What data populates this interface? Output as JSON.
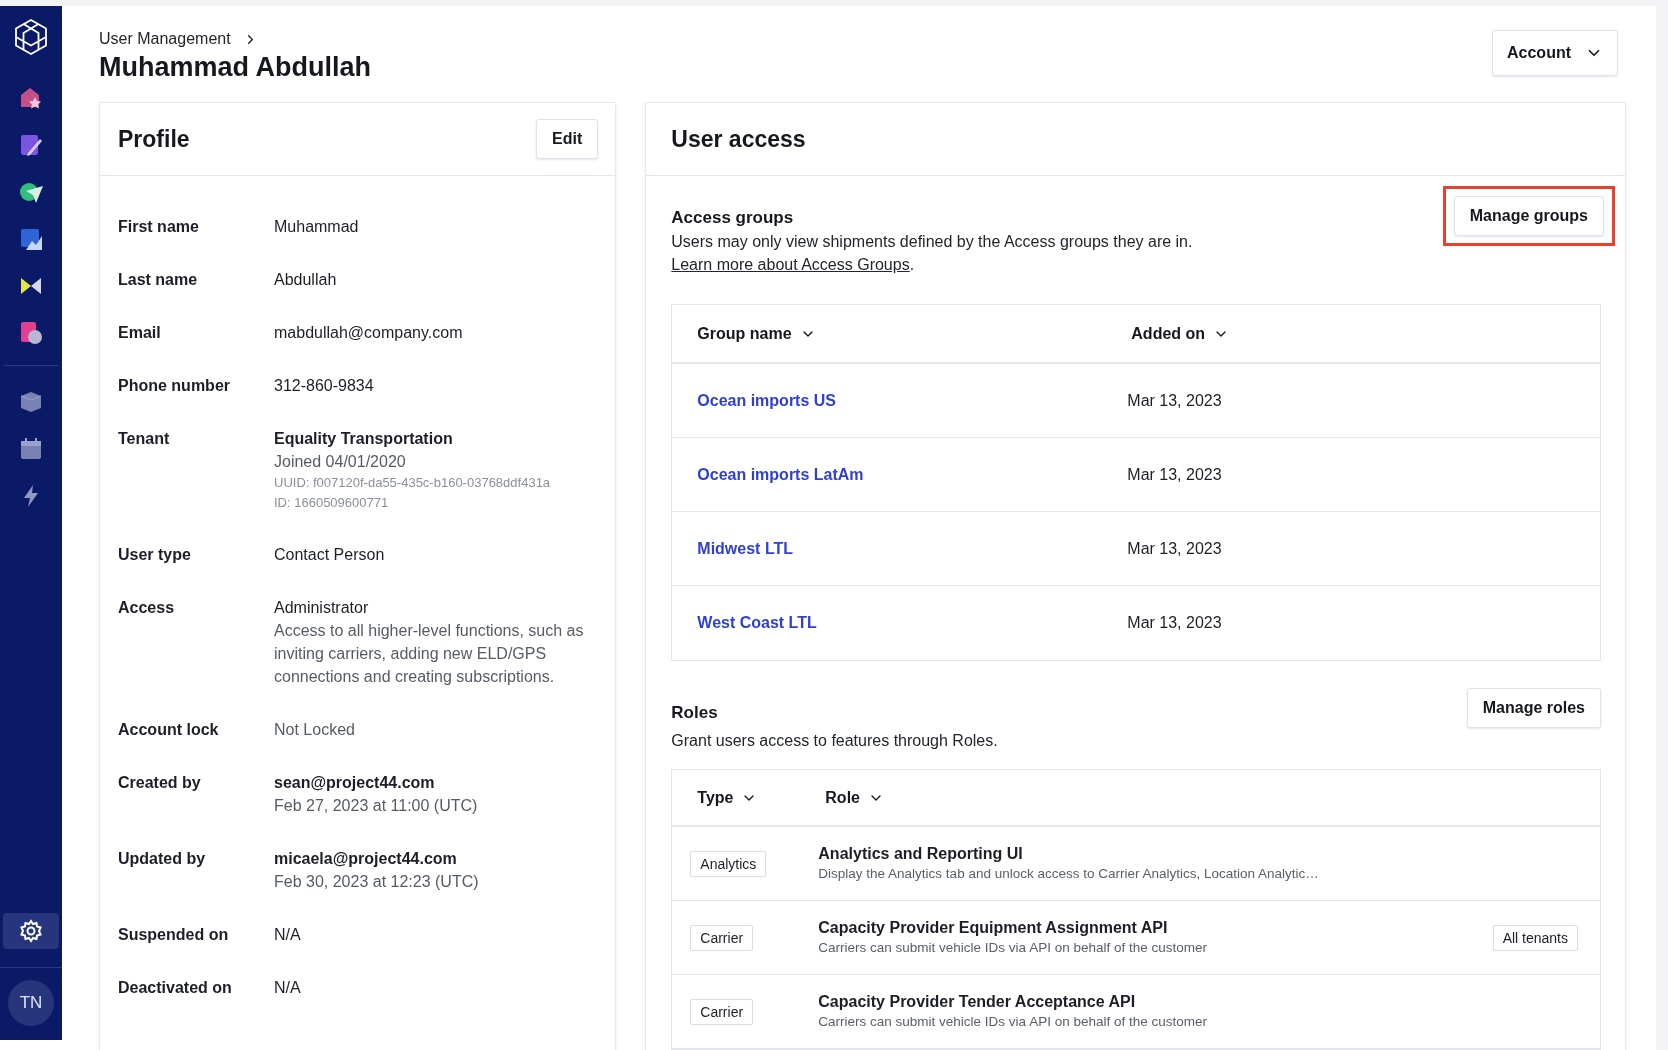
{
  "sidebar": {
    "primary": [
      {
        "selected": false
      },
      {
        "selected": false
      },
      {
        "selected": false
      },
      {
        "selected": false
      },
      {
        "selected": false
      },
      {
        "selected": false
      }
    ],
    "secondary": [
      {
        "selected": false
      },
      {
        "selected": false
      },
      {
        "selected": false
      }
    ],
    "footer": [
      {
        "selected": true
      }
    ],
    "avatar": {
      "initials": "TN"
    }
  },
  "header": {
    "breadcrumb": "User Management",
    "title": "Muhammad Abdullah",
    "account_button": "Account"
  },
  "profile": {
    "title": "Profile",
    "edit_button": "Edit",
    "fields": [
      {
        "label": "First name",
        "lines": [
          {
            "kind": "value",
            "text": "Muhammad"
          }
        ]
      },
      {
        "label": "Last name",
        "lines": [
          {
            "kind": "value",
            "text": "Abdullah"
          }
        ]
      },
      {
        "label": "Email",
        "lines": [
          {
            "kind": "value",
            "text": "mabdullah@company.com"
          }
        ]
      },
      {
        "label": "Phone number",
        "lines": [
          {
            "kind": "value",
            "text": "312-860-9834"
          }
        ]
      },
      {
        "label": "Tenant",
        "lines": [
          {
            "kind": "strong",
            "text": "Equality Transportation"
          },
          {
            "kind": "secondary",
            "text": "Joined 04/01/2020"
          },
          {
            "kind": "meta",
            "text": "UUID: f007120f-da55-435c-b160-03768ddf431a"
          },
          {
            "kind": "meta",
            "text": "ID: 1660509600771"
          }
        ]
      },
      {
        "label": "User type",
        "lines": [
          {
            "kind": "value",
            "text": "Contact Person"
          }
        ]
      },
      {
        "label": "Access",
        "lines": [
          {
            "kind": "value",
            "text": "Administrator"
          },
          {
            "kind": "secondary",
            "text": "Access to all higher-level functions, such as inviting carriers, adding new ELD/GPS connections and creating subscriptions."
          }
        ]
      },
      {
        "label": "Account lock",
        "lines": [
          {
            "kind": "secondary",
            "text": "Not Locked"
          }
        ]
      },
      {
        "label": "Created by",
        "lines": [
          {
            "kind": "strong",
            "text": "sean@project44.com"
          },
          {
            "kind": "secondary",
            "text": "Feb 27, 2023 at 11:00 (UTC)"
          }
        ]
      },
      {
        "label": "Updated by",
        "lines": [
          {
            "kind": "strong",
            "text": "micaela@project44.com"
          },
          {
            "kind": "secondary",
            "text": "Feb 30, 2023 at 12:23 (UTC)"
          }
        ]
      },
      {
        "label": "Suspended on",
        "lines": [
          {
            "kind": "value",
            "text": "N/A"
          }
        ]
      },
      {
        "label": "Deactivated on",
        "lines": [
          {
            "kind": "value",
            "text": "N/A"
          }
        ]
      }
    ]
  },
  "user_access": {
    "title": "User access",
    "access_groups": {
      "title": "Access groups",
      "description": "Users may only view shipments defined by the Access groups they are in.",
      "link": "Learn more about Access Groups",
      "link_suffix": ".",
      "button": "Manage groups",
      "button_highlighted": true,
      "columns": [
        "Group name",
        "Added on"
      ],
      "rows": [
        {
          "name": "Ocean imports US",
          "added_on": "Mar 13, 2023"
        },
        {
          "name": "Ocean imports LatAm",
          "added_on": "Mar 13, 2023"
        },
        {
          "name": "Midwest LTL",
          "added_on": "Mar 13, 2023"
        },
        {
          "name": "West Coast LTL",
          "added_on": "Mar 13, 2023"
        }
      ]
    },
    "roles": {
      "title": "Roles",
      "description": "Grant users access to features through Roles.",
      "button": "Manage roles",
      "columns": [
        "Type",
        "Role"
      ],
      "rows": [
        {
          "type": "Analytics",
          "role": "Analytics and Reporting UI",
          "description": "Display the Analytics tab and unlock access to Carrier Analytics, Location Analytic…"
        },
        {
          "type": "Carrier",
          "role": "Capacity Provider Equipment Assignment API",
          "description": "Carriers can submit vehicle IDs via API on behalf of the customer",
          "scope": "All tenants"
        },
        {
          "type": "Carrier",
          "role": "Capacity Provider Tender Acceptance API",
          "description": "Carriers can submit vehicle IDs via API on behalf of the customer"
        }
      ]
    }
  }
}
